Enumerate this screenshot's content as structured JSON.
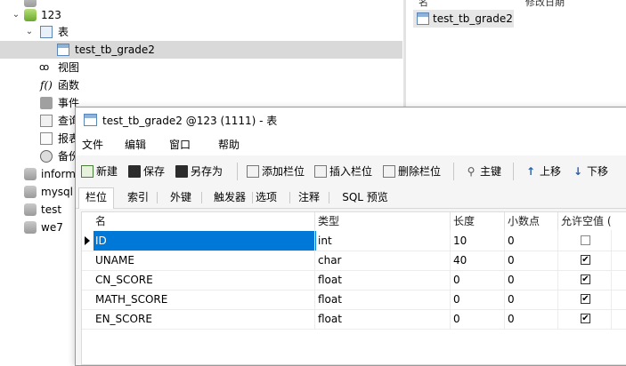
{
  "tree": {
    "db_123": "123",
    "folder_tables": "表",
    "table_selected": "test_tb_grade2",
    "folder_views": "视图",
    "folder_functions": "函数",
    "folder_events": "事件",
    "folder_queries": "查询",
    "folder_reports": "报表",
    "folder_backups": "备份",
    "db_information": "information_schema",
    "db_mysql": "mysql",
    "db_test": "test",
    "db_we7": "we7"
  },
  "objects": {
    "col_name": "名",
    "col_modified": "修改日期",
    "item": "test_tb_grade2"
  },
  "dialog": {
    "title": "test_tb_grade2 @123 (1111) - 表",
    "menu": [
      "文件",
      "编辑",
      "窗口",
      "帮助"
    ],
    "toolbar": {
      "new": "新建",
      "save": "保存",
      "save_as": "另存为",
      "add_field": "添加栏位",
      "insert_field": "插入栏位",
      "delete_field": "删除栏位",
      "primary_key": "主键",
      "move_up": "上移",
      "move_down": "下移"
    },
    "tabs": [
      "栏位",
      "索引",
      "外键",
      "触发器",
      "选项",
      "注释",
      "SQL 预览"
    ],
    "active_tab": "栏位",
    "columns": [
      "名",
      "类型",
      "长度",
      "小数点",
      "允许空值 ("
    ],
    "rows": [
      {
        "name": "ID",
        "type": "int",
        "length": "10",
        "decimals": "0",
        "nullable": false
      },
      {
        "name": "UNAME",
        "type": "char",
        "length": "40",
        "decimals": "0",
        "nullable": true
      },
      {
        "name": "CN_SCORE",
        "type": "float",
        "length": "0",
        "decimals": "0",
        "nullable": true
      },
      {
        "name": "MATH_SCORE",
        "type": "float",
        "length": "0",
        "decimals": "0",
        "nullable": true
      },
      {
        "name": "EN_SCORE",
        "type": "float",
        "length": "0",
        "decimals": "0",
        "nullable": true
      }
    ],
    "selected_row": 0
  },
  "colors": {
    "selection": "#0078d7",
    "tree_selection": "#d9d9d9",
    "db_green": "#6aa82a"
  }
}
